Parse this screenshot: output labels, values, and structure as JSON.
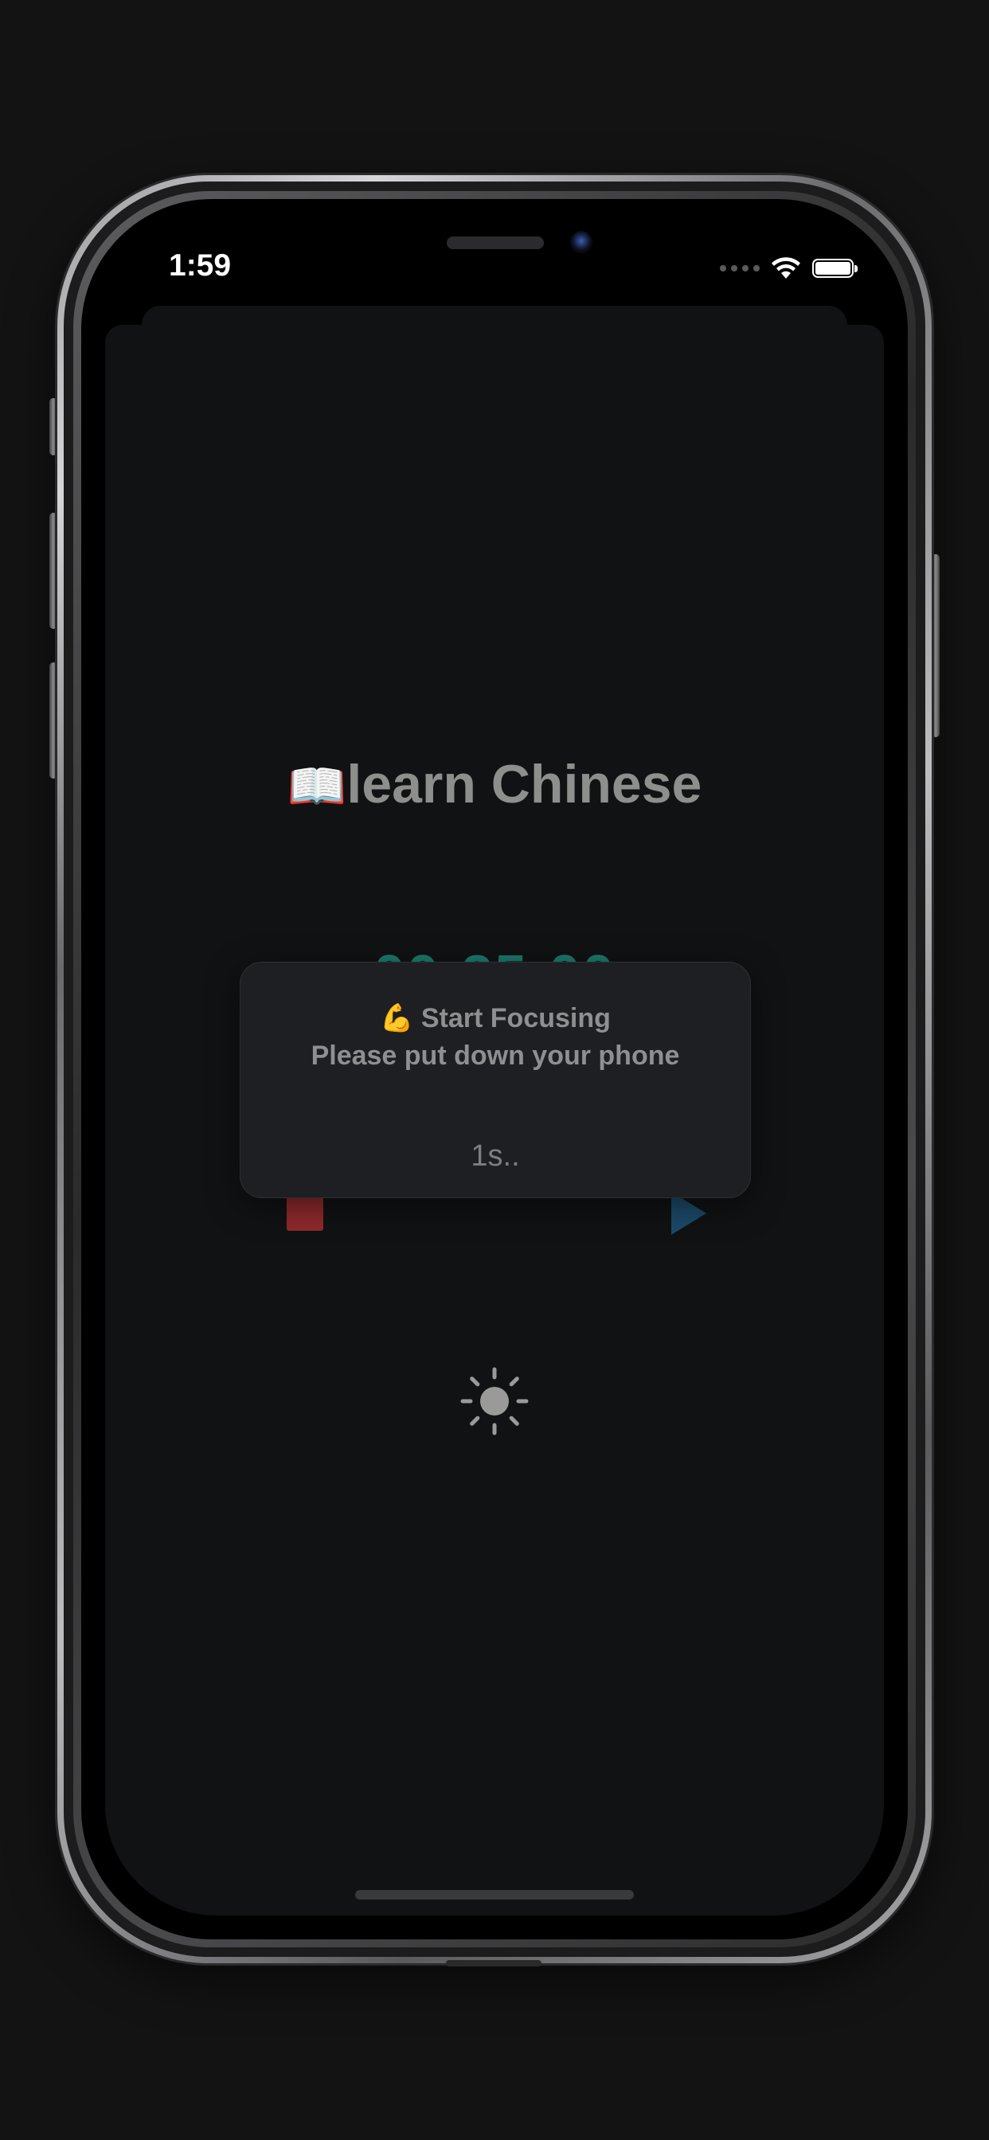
{
  "status_bar": {
    "time": "1:59"
  },
  "task": {
    "emoji": "📖",
    "name": "learn Chinese"
  },
  "timer": {
    "display": "00:25:00"
  },
  "modal": {
    "emoji": "💪",
    "title": "Start Focusing",
    "message": "Please put down your phone",
    "countdown": "1s.."
  },
  "colors": {
    "background": "#111214",
    "timer": "#1b7a6a",
    "stop": "#8f2a2c",
    "play": "#1c4a6a",
    "text_muted": "#8e8e8c"
  },
  "icons": {
    "stop": "stop-icon",
    "play": "play-icon",
    "brightness": "sun-icon",
    "wifi": "wifi-icon",
    "battery": "battery-icon"
  }
}
